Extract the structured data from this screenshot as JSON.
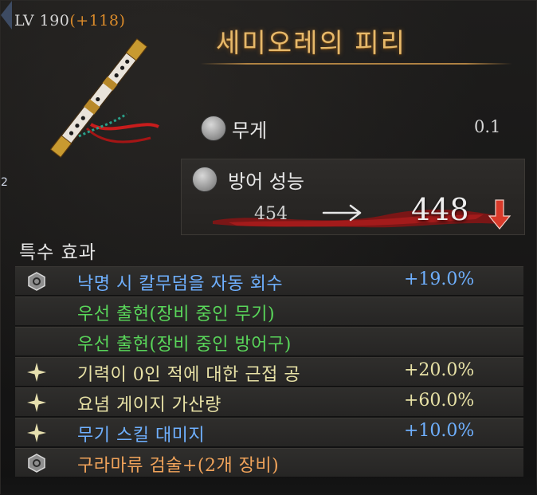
{
  "level": {
    "label": "LV 190",
    "bonus": "(+118)"
  },
  "item": {
    "name": "세미오레의 피리",
    "icon": "flute-icon"
  },
  "side_badge": {
    "number": "2"
  },
  "weight": {
    "label": "무게",
    "value": "0.1",
    "icon": "weight-icon"
  },
  "defense": {
    "label": "방어 성능",
    "previous": "454",
    "current": "448",
    "trend": "decrease",
    "icon": "armor-icon"
  },
  "effects": {
    "title": "특수 효과",
    "rows": [
      {
        "text": "낙명 시 칼무덤을 자동 회수",
        "value": "+19.0%",
        "icon": "hexagon-icon",
        "text_color": "#6fb0ff",
        "value_color": "#6fb0ff"
      },
      {
        "text": "우선 출현(장비 중인 무기)",
        "value": "",
        "icon": "",
        "text_color": "#59d65a",
        "value_color": "#59d65a"
      },
      {
        "text": "우선 출현(장비 중인 방어구)",
        "value": "",
        "icon": "",
        "text_color": "#59d65a",
        "value_color": "#59d65a"
      },
      {
        "text": "기력이 0인 적에 대한 근접 공",
        "value": "+20.0%",
        "icon": "sparkle-icon",
        "text_color": "#e8e2a6",
        "value_color": "#e8e2a6"
      },
      {
        "text": "요념 게이지 가산량",
        "value": "+60.0%",
        "icon": "sparkle-icon",
        "text_color": "#e8e2a6",
        "value_color": "#e8e2a6"
      },
      {
        "text": "무기 스킬 대미지",
        "value": "+10.0%",
        "icon": "sparkle-icon",
        "text_color": "#6fb0ff",
        "value_color": "#6fb0ff"
      },
      {
        "text": "구라마류 검술+(2개 장비)",
        "value": "",
        "icon": "hexagon-icon",
        "text_color": "#f0a35a",
        "value_color": "#f0a35a"
      }
    ]
  },
  "colors": {
    "title": "#e7b96a",
    "bonus": "#d98a2a",
    "arrow_down": "#d93a2a"
  }
}
